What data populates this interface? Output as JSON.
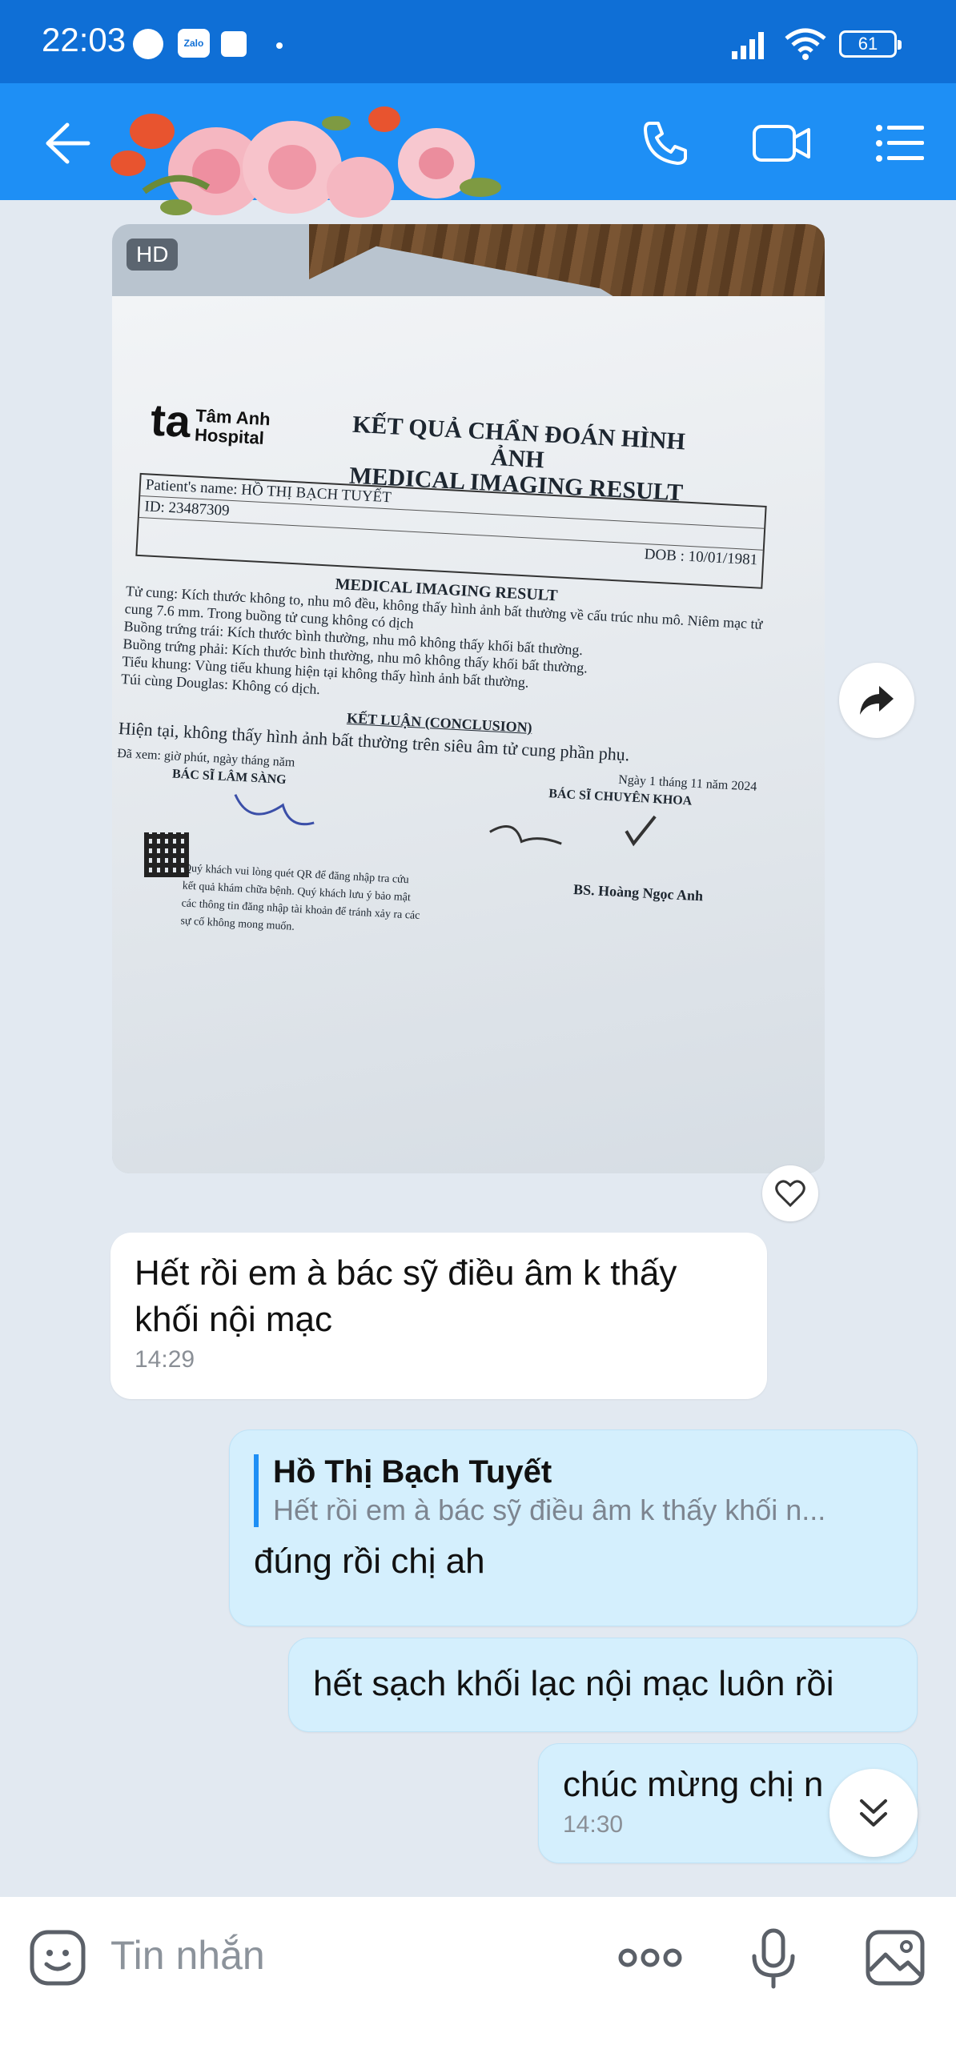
{
  "status_bar": {
    "time": "22:03",
    "battery": "61",
    "zalo_label": "Zalo"
  },
  "header": {
    "icons": [
      "back-arrow-icon",
      "phone-icon",
      "video-call-icon",
      "list-menu-icon"
    ]
  },
  "image_message": {
    "badge": "HD",
    "document": {
      "hospital_logo": "ta",
      "hospital_name": "Tâm Anh Hospital",
      "title_vi": "KẾT QUẢ CHẨN ĐOÁN HÌNH ẢNH",
      "title_en": "MEDICAL IMAGING RESULT",
      "patient_name": "Patient's name: HỒ THỊ BẠCH TUYẾT",
      "patient_id": "ID: 23487309",
      "dob": "DOB : 10/01/1981",
      "section": "MEDICAL IMAGING RESULT",
      "lines": [
        "Tử cung: Kích thước không to, nhu mô đều, không thấy hình ảnh bất thường về cấu trúc nhu mô. Niêm mạc tử cung 7.6 mm. Trong buồng tử cung không có dịch",
        "Buồng trứng trái: Kích thước bình thường, nhu mô không thấy khối bất thường.",
        "Buồng trứng phải: Kích thước bình thường, nhu mô không thấy khối bất thường.",
        "Tiểu khung: Vùng tiểu khung hiện tại không thấy hình ảnh bất thường.",
        "Túi cùng Douglas: Không có dịch."
      ],
      "conclusion_title": "KẾT LUẬN (CONCLUSION)",
      "conclusion": "Hiện tại, không thấy hình ảnh bất thường trên siêu âm tử cung phần phụ.",
      "seen": "Đã xem: giờ phút, ngày tháng năm",
      "date": "Ngày 1 tháng 11 năm 2024",
      "clinical_doctor": "BÁC SĨ LÂM SÀNG",
      "specialist_doctor": "BÁC SĨ CHUYÊN KHOA",
      "specialist_name": "BS. Hoàng Ngọc Anh",
      "qr_note": "Quý khách vui lòng quét QR để đăng nhập tra cứu kết quả khám chữa bệnh. Quý khách lưu ý bảo mật các thông tin đăng nhập tài khoản để tránh xảy ra các sự cố không mong muốn."
    }
  },
  "messages": [
    {
      "direction": "in",
      "text": "Hết rồi em à bác sỹ điều âm k thấy khối nội mạc",
      "time": "14:29"
    },
    {
      "direction": "out",
      "quote_name": "Hồ Thị Bạch Tuyết",
      "quote_text": "Hết rồi em à bác sỹ điều âm k thấy khối n...",
      "text": "đúng rồi chị ah"
    },
    {
      "direction": "out",
      "text": "hết sạch khối lạc nội mạc luôn rồi"
    },
    {
      "direction": "out",
      "text": "chúc mừng chị n",
      "time": "14:30"
    }
  ],
  "input": {
    "placeholder": "Tin nhắn"
  },
  "colors": {
    "header": "#1e8ff5",
    "status_bar": "#0f6fd6",
    "chat_bg": "#e2e9f1",
    "outgoing_bubble": "#d4effd"
  }
}
